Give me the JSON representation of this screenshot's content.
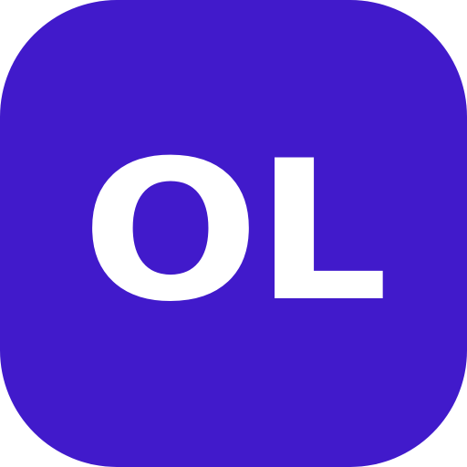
{
  "icon": {
    "monogram": "OL",
    "background_color": "#411ACB",
    "text_color": "#FFFFFF"
  }
}
